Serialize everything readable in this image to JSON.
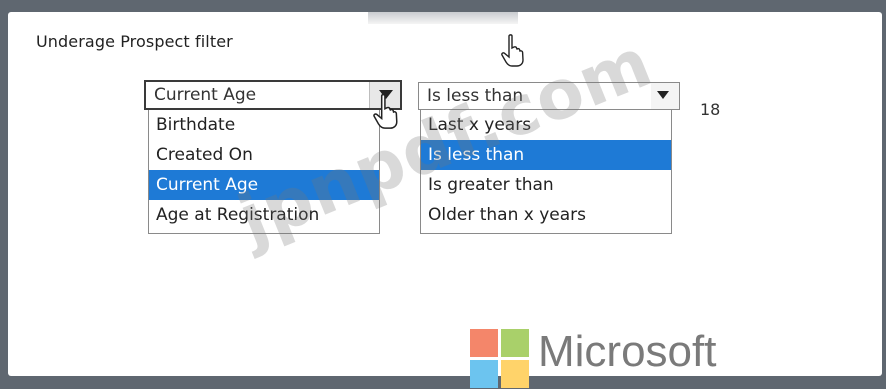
{
  "panel": {
    "title": "Underage Prospect filter"
  },
  "field_dropdown": {
    "selected": "Current Age",
    "options": [
      {
        "label": "Birthdate",
        "selected": false
      },
      {
        "label": "Created On",
        "selected": false
      },
      {
        "label": "Current Age",
        "selected": true
      },
      {
        "label": "Age at Registration",
        "selected": false
      }
    ]
  },
  "operator_dropdown": {
    "selected": "Is less than",
    "options": [
      {
        "label": "Last x years",
        "selected": false
      },
      {
        "label": "Is less than",
        "selected": true
      },
      {
        "label": "Is greater than",
        "selected": false
      },
      {
        "label": "Older than x years",
        "selected": false
      }
    ]
  },
  "value": "18",
  "watermark": "jpnpdf.com",
  "brand": {
    "name": "Microsoft",
    "colors": {
      "red": "#f25022",
      "green": "#7fba00",
      "blue": "#00a4ef",
      "yellow": "#ffb900"
    }
  },
  "colors": {
    "selection": "#1e7ad6",
    "frame": "#5f6770"
  },
  "icons": {
    "cursor": "hand-pointer-icon",
    "dropdown": "triangle-down-icon"
  }
}
